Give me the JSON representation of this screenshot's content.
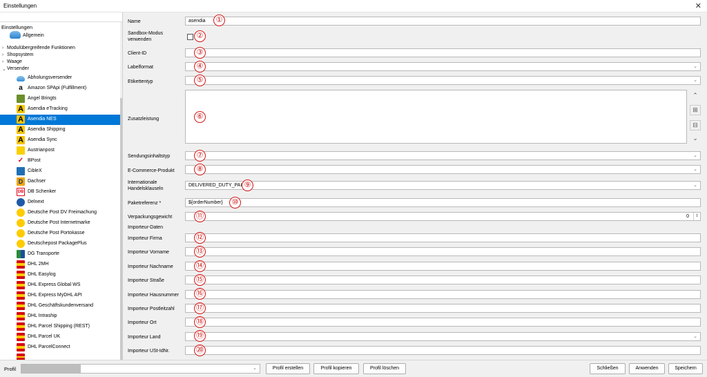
{
  "window": {
    "title": "Einstellungen"
  },
  "tree": {
    "root": "Einstellungen",
    "items": [
      {
        "label": "Allgemein",
        "icon": "cloud-icon"
      },
      {
        "label": "Modulübergreifende Funktionen",
        "icon": "expand-arrow-icon"
      },
      {
        "label": "Shopsystem",
        "icon": "expand-arrow-icon"
      },
      {
        "label": "Waage",
        "icon": "expand-arrow-icon"
      },
      {
        "label": "Versender",
        "icon": "collapse-arrow-icon"
      },
      {
        "label": "Abholungsversender",
        "icon": "cloud-icon"
      },
      {
        "label": "Amazon SPApi (Fulfillment)",
        "icon": "amazon-icon"
      },
      {
        "label": "Angel Bringts",
        "icon": "angel-bringts-icon"
      },
      {
        "label": "Asendia eTracking",
        "icon": "asendia-icon"
      },
      {
        "label": "Asendia NES",
        "icon": "asendia-icon",
        "selected": true
      },
      {
        "label": "Asendia Shipping",
        "icon": "asendia-icon"
      },
      {
        "label": "Asendia Sync",
        "icon": "asendia-icon"
      },
      {
        "label": "Austrianpost",
        "icon": "austrianpost-icon"
      },
      {
        "label": "BPost",
        "icon": "bpost-icon"
      },
      {
        "label": "CibleX",
        "icon": "ciblex-icon"
      },
      {
        "label": "Dachser",
        "icon": "dachser-icon"
      },
      {
        "label": "DB Schenker",
        "icon": "db-schenker-icon"
      },
      {
        "label": "Delnext",
        "icon": "delnext-icon"
      },
      {
        "label": "Deutsche Post DV Freimachung",
        "icon": "deutsche-post-icon"
      },
      {
        "label": "Deutsche Post Internetmarke",
        "icon": "deutsche-post-icon"
      },
      {
        "label": "Deutsche Post Portokasse",
        "icon": "deutsche-post-icon"
      },
      {
        "label": "Deutschepost PackagePlus",
        "icon": "deutsche-post-icon"
      },
      {
        "label": "DG Transporte",
        "icon": "dg-transporte-icon"
      },
      {
        "label": "DHL 2MH",
        "icon": "dhl-icon"
      },
      {
        "label": "DHL Easylog",
        "icon": "dhl-icon"
      },
      {
        "label": "DHL Express Global WS",
        "icon": "dhl-icon"
      },
      {
        "label": "DHL Express MyDHL API",
        "icon": "dhl-icon"
      },
      {
        "label": "DHL Geschäftskundenversand",
        "icon": "dhl-icon"
      },
      {
        "label": "DHL Intraship",
        "icon": "dhl-icon"
      },
      {
        "label": "DHL Parcel Shipping (REST)",
        "icon": "dhl-icon"
      },
      {
        "label": "DHL Parcel UK",
        "icon": "dhl-icon"
      },
      {
        "label": "DHL ParcelConnect",
        "icon": "dhl-icon"
      }
    ]
  },
  "form": {
    "name": {
      "label": "Name",
      "value": "asendia",
      "marker": "①"
    },
    "sandbox": {
      "label_line1": "Sandbox-Modus",
      "label_line2": "verwenden",
      "marker": "②"
    },
    "client_id": {
      "label": "Client-ID",
      "marker": "③"
    },
    "labelformat": {
      "label": "Labelformat",
      "marker": "④"
    },
    "etikettentyp": {
      "label": "Etikettentyp",
      "marker": "⑤"
    },
    "zusatzleistung": {
      "label": "Zusatzleistung",
      "marker": "⑥"
    },
    "sendungsinhaltstyp": {
      "label": "Sendungsinhaltstyp",
      "marker": "⑦"
    },
    "ecommerce": {
      "label": "E-Commerce-Produkt",
      "marker": "⑧"
    },
    "incoterms": {
      "label_line1": "Internationale",
      "label_line2": "Handelsklauseln",
      "value": "DELIVERED_DUTY_PAID",
      "marker": "⑨"
    },
    "paketreferenz": {
      "label": "Paketreferenz *",
      "value": "${orderNumber}",
      "marker": "⑩"
    },
    "verpackungsgewicht": {
      "label": "Verpackungsgewicht",
      "value": "0",
      "marker": "⑪"
    },
    "importeur_daten": {
      "label": "Importeur-Daten"
    },
    "importeur_firma": {
      "label": "Importeur Firma",
      "marker": "⑫"
    },
    "importeur_vorname": {
      "label": "Importeur Vorname",
      "marker": "⑬"
    },
    "importeur_nachname": {
      "label": "Importeur Nachname",
      "marker": "⑭"
    },
    "importeur_strasse": {
      "label": "Importeur Straße",
      "marker": "⑮"
    },
    "importeur_hausnummer": {
      "label": "Importeur Hausnummer",
      "marker": "⑯"
    },
    "importeur_plz": {
      "label": "Importeur Postleitzahl",
      "marker": "⑰"
    },
    "importeur_ort": {
      "label": "Importeur Ort",
      "marker": "⑱"
    },
    "importeur_land": {
      "label": "Importeur Land",
      "marker": "⑲"
    },
    "importeur_ust": {
      "label": "Importeur USt-IdNr.",
      "marker": "⑳"
    }
  },
  "bottom": {
    "profil_label": "Profil",
    "profil_erstellen": "Profil erstellen",
    "profil_kopieren": "Profil kopieren",
    "profil_loeschen": "Profil löschen",
    "schliessen": "Schließen",
    "anwenden": "Anwenden",
    "speichern": "Speichern"
  }
}
